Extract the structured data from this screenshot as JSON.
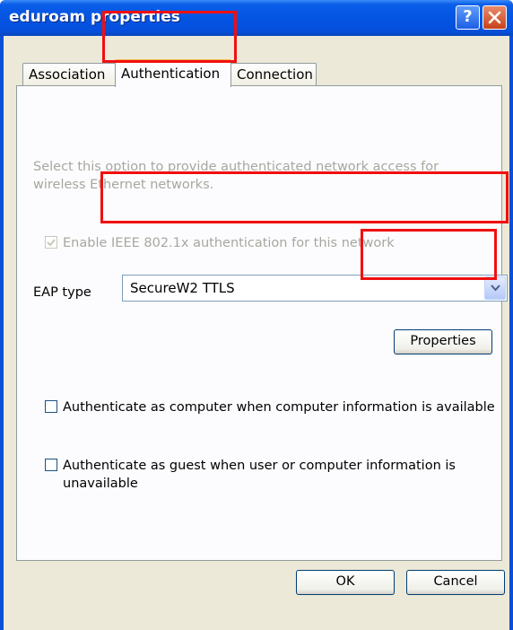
{
  "window": {
    "title": "eduroam properties",
    "help_icon": "question-mark",
    "close_icon": "x-mark"
  },
  "tabs": [
    {
      "label": "Association"
    },
    {
      "label": "Authentication",
      "selected": true
    },
    {
      "label": "Connection"
    }
  ],
  "panel": {
    "description": "Select this option to provide authenticated network access for wireless Ethernet networks.",
    "ieee_checkbox": {
      "label": "Enable IEEE 802.1x authentication for this network",
      "checked": true,
      "disabled": true
    },
    "eap_type": {
      "label": "EAP type",
      "value": "SecureW2 TTLS"
    },
    "properties_button": "Properties",
    "auth_computer_checkbox": {
      "label": "Authenticate as computer when computer information is available",
      "checked": false
    },
    "auth_guest_checkbox": {
      "label": "Authenticate as guest when user or computer information is unavailable",
      "checked": false
    }
  },
  "footer": {
    "ok_label": "OK",
    "cancel_label": "Cancel"
  },
  "colors": {
    "titlebar": "#0454e2",
    "dialog_bg": "#ece9d8",
    "highlight": "#f01010"
  }
}
